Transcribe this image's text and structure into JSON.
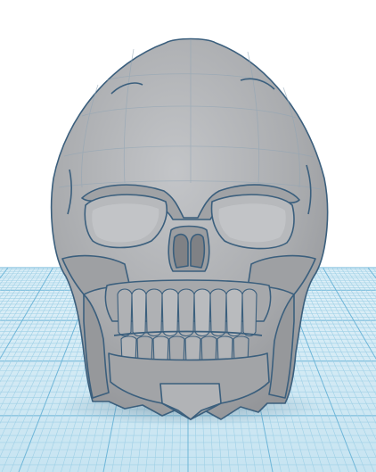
{
  "scene": {
    "type": "3d-workplane-viewport",
    "object": "skull-model",
    "colors": {
      "background": "#ffffff",
      "grid_fill": "#cfe7f2",
      "grid_minor": "#9fd0e6",
      "grid_major": "#6fb6d8",
      "model_fill": "#a9abae",
      "model_shade": "#8e9094",
      "model_highlight": "#c3c5c8",
      "model_edge": "#3b5f7d",
      "cavity": "#b5b7ba",
      "shadow": "#5f7f94"
    }
  }
}
